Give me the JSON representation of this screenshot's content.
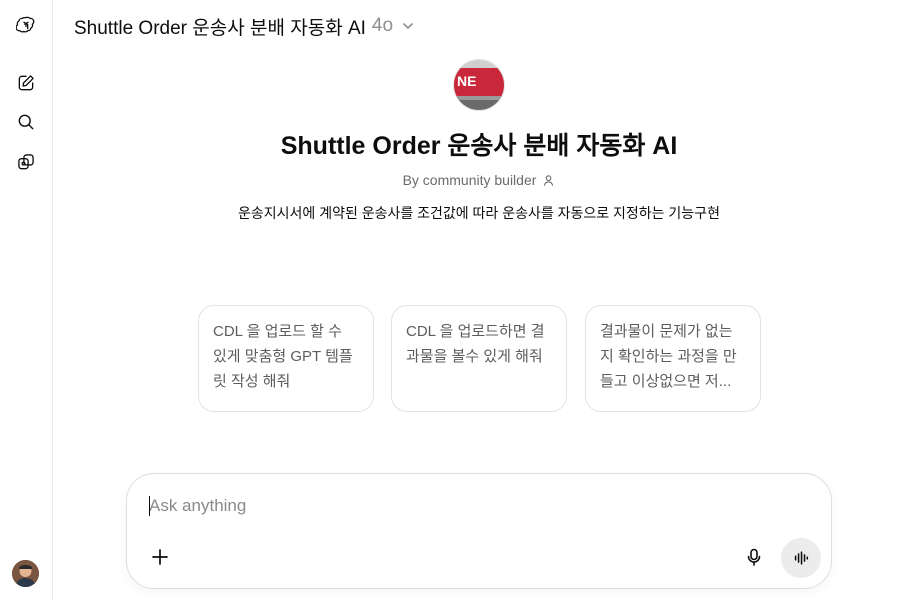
{
  "header": {
    "title": "Shuttle Order 운송사 분배 자동화 AI",
    "model": "4o",
    "icon": "chevron-down-icon"
  },
  "sidebar": {
    "items": [
      {
        "icon": "openai-logo-icon",
        "label": "ChatGPT"
      },
      {
        "icon": "new-chat-icon",
        "label": "New chat"
      },
      {
        "icon": "search-icon",
        "label": "Search chats"
      },
      {
        "icon": "explore-gpts-icon",
        "label": "GPTs"
      }
    ],
    "user_avatar": "user-avatar"
  },
  "gpt": {
    "name": "Shuttle Order 운송사 분배 자동화 AI",
    "byline": "By community builder",
    "description": "운송지시서에 계약된 운송사를 조건값에 따라 운송사를 자동으로 지정하는 기능구현"
  },
  "starters": [
    {
      "text": "CDL 을 업로드 할 수 있게 맞춤형 GPT 템플릿 작성 해줘"
    },
    {
      "text": "CDL 을 업로드하면 결과물을 볼수 있게 해줘"
    },
    {
      "text": "결과물이 문제가 없는지 확인하는 과정을 만들고 이상없으면 저..."
    }
  ],
  "composer": {
    "placeholder": "Ask anything",
    "value": ""
  },
  "colors": {
    "text": "#0d0d0d",
    "muted": "#8f8f8f",
    "border": "#e3e3e3",
    "voice_bg": "#ececec"
  }
}
